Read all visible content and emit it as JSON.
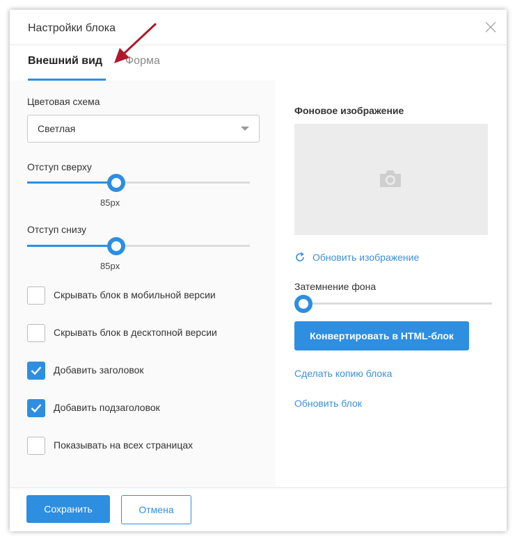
{
  "dialog": {
    "title": "Настройки блока",
    "close_icon": "close-icon"
  },
  "tabs": [
    {
      "label": "Внешний вид",
      "active": true
    },
    {
      "label": "Форма",
      "active": false
    }
  ],
  "appearance": {
    "color_scheme": {
      "label": "Цветовая схема",
      "value": "Светлая"
    },
    "padding_top": {
      "label": "Отступ сверху",
      "value": "85px",
      "fraction": 0.4
    },
    "padding_bottom": {
      "label": "Отступ снизу",
      "value": "85px",
      "fraction": 0.4
    },
    "checkboxes": [
      {
        "label": "Скрывать блок в мобильной версии",
        "checked": false
      },
      {
        "label": "Скрывать блок в десктопной версии",
        "checked": false
      },
      {
        "label": "Добавить заголовок",
        "checked": true
      },
      {
        "label": "Добавить подзаголовок",
        "checked": true
      },
      {
        "label": "Показывать на всех страницах",
        "checked": false
      }
    ]
  },
  "background": {
    "title": "Фоновое изображение",
    "placeholder_icon": "camera-icon",
    "refresh_link": "Обновить изображение",
    "dim_label": "Затемнение фона",
    "dim_fraction": 0,
    "convert_button": "Конвертировать в HTML-блок",
    "copy_link": "Сделать копию блока",
    "update_link": "Обновить блок"
  },
  "footer": {
    "save": "Сохранить",
    "cancel": "Отмена"
  },
  "colors": {
    "accent": "#2e8ee0",
    "arrow": "#b0182b"
  }
}
